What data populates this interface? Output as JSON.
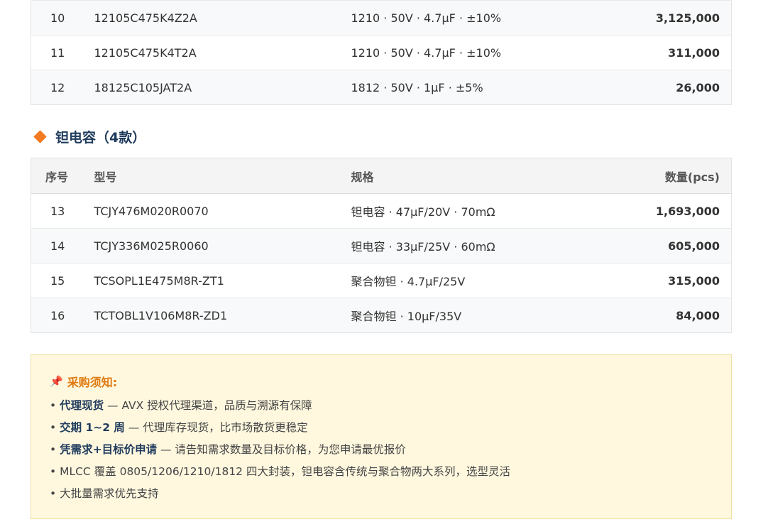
{
  "mlcc_rows": [
    {
      "idx": "10",
      "model": "12105C475K4Z2A",
      "spec": "1210 · 50V · 4.7μF · ±10%",
      "qty": "3,125,000"
    },
    {
      "idx": "11",
      "model": "12105C475K4T2A",
      "spec": "1210 · 50V · 4.7μF · ±10%",
      "qty": "311,000"
    },
    {
      "idx": "12",
      "model": "18125C105JAT2A",
      "spec": "1812 · 50V · 1μF · ±5%",
      "qty": "26,000"
    }
  ],
  "tantalum": {
    "title": "钽电容（4款）",
    "headers": {
      "idx": "序号",
      "model": "型号",
      "spec": "规格",
      "qty": "数量(pcs)"
    },
    "rows": [
      {
        "idx": "13",
        "model": "TCJY476M020R0070",
        "spec": "钽电容 · 47μF/20V · 70mΩ",
        "qty": "1,693,000"
      },
      {
        "idx": "14",
        "model": "TCJY336M025R0060",
        "spec": "钽电容 · 33μF/25V · 60mΩ",
        "qty": "605,000"
      },
      {
        "idx": "15",
        "model": "TCSOPL1E475M8R-ZT1",
        "spec": "聚合物钽 · 4.7μF/25V",
        "qty": "315,000"
      },
      {
        "idx": "16",
        "model": "TCTOBL1V106M8R-ZD1",
        "spec": "聚合物钽 · 10μF/35V",
        "qty": "84,000"
      }
    ]
  },
  "notice": {
    "title": "采购须知:",
    "icon": "pushpin-icon",
    "items": [
      {
        "bold": "代理现货",
        "rest": " — AVX 授权代理渠道，品质与溯源有保障"
      },
      {
        "bold": "交期 1~2 周",
        "rest": " — 代理库存现货，比市场散货更稳定"
      },
      {
        "bold": "凭需求+目标价申请",
        "rest": " — 请告知需求数量及目标价格，为您申请最优报价"
      },
      {
        "bold": "",
        "rest": "MLCC 覆盖 0805/1206/1210/1812 四大封装，钽电容含传统与聚合物两大系列，选型灵活"
      },
      {
        "bold": "",
        "rest": "大批量需求优先支持"
      }
    ]
  },
  "colors": {
    "accent": "#f27a21",
    "heading": "#1f3b5c",
    "notice_bg": "#fff8df"
  }
}
